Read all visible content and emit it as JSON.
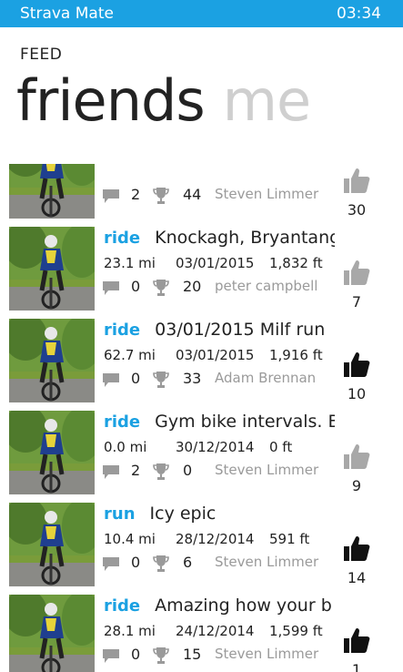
{
  "statusbar": {
    "app_title": "Strava Mate",
    "time": "03:34"
  },
  "header": {
    "section": "FEED",
    "pivot_active": "friends",
    "pivot_inactive": "me"
  },
  "colors": {
    "accent": "#1ba1e2",
    "kudos_given": "#111111",
    "kudos_not_given": "#a8a8a8",
    "muted_text": "#9a9a9a"
  },
  "feed": [
    {
      "type": "",
      "title": "",
      "distance": "",
      "date": "",
      "elevation": "",
      "comments": "2",
      "trophies": "44",
      "athlete": "Steven Limmer",
      "kudos": "30",
      "kudos_given": false
    },
    {
      "type": "ride",
      "title": "Knockagh, Bryantang",
      "distance": "23.1 mi",
      "date": "03/01/2015",
      "elevation": "1,832 ft",
      "comments": "0",
      "trophies": "20",
      "athlete": "peter campbell",
      "kudos": "7",
      "kudos_given": false
    },
    {
      "type": "ride",
      "title": "03/01/2015 Milf run",
      "distance": "62.7 mi",
      "date": "03/01/2015",
      "elevation": "1,916 ft",
      "comments": "0",
      "trophies": "33",
      "athlete": "Adam Brennan",
      "kudos": "10",
      "kudos_given": true
    },
    {
      "type": "ride",
      "title": "Gym bike intervals. B",
      "distance": "0.0 mi",
      "date": "30/12/2014",
      "elevation": "0 ft",
      "comments": "2",
      "trophies": "0",
      "athlete": "Steven Limmer",
      "kudos": "9",
      "kudos_given": false
    },
    {
      "type": "run",
      "title": "Icy epic",
      "distance": "10.4 mi",
      "date": "28/12/2014",
      "elevation": "591 ft",
      "comments": "0",
      "trophies": "6",
      "athlete": "Steven Limmer",
      "kudos": "14",
      "kudos_given": true
    },
    {
      "type": "ride",
      "title": "Amazing how your b",
      "distance": "28.1 mi",
      "date": "24/12/2014",
      "elevation": "1,599 ft",
      "comments": "0",
      "trophies": "15",
      "athlete": "Steven Limmer",
      "kudos": "1",
      "kudos_given": true
    }
  ]
}
